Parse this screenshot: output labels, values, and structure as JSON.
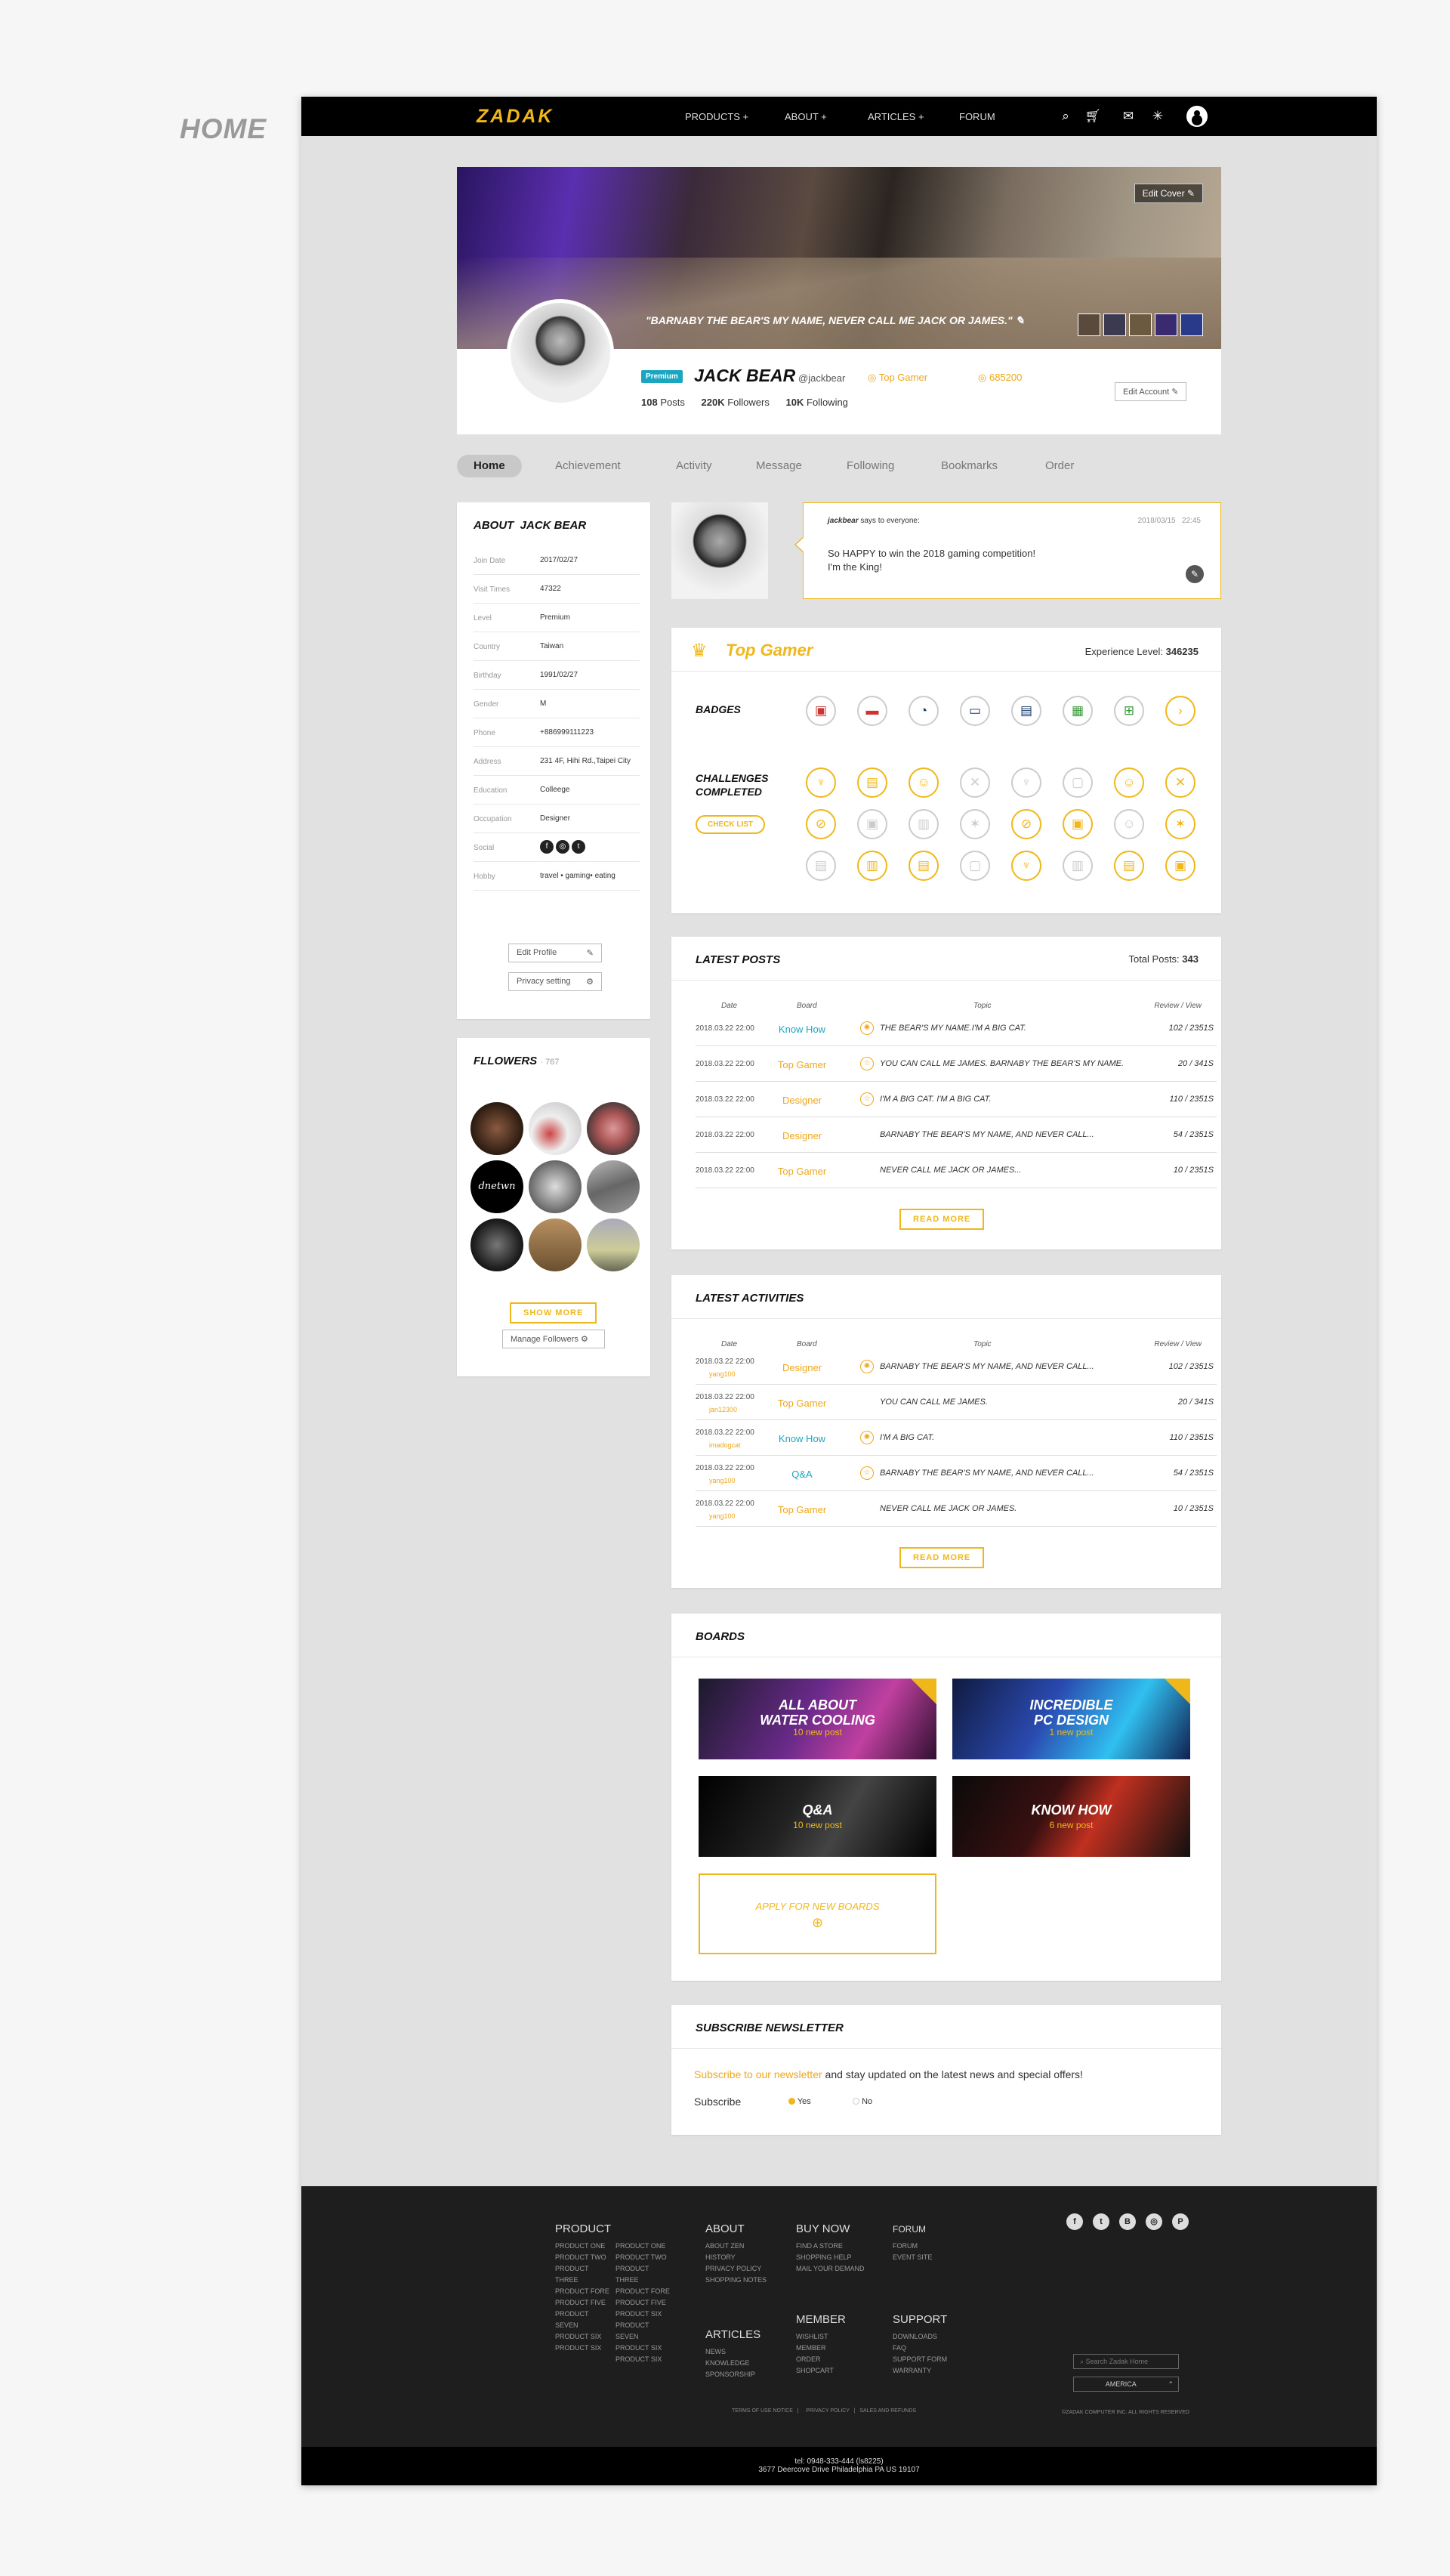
{
  "page_label": "HOME",
  "nav": {
    "logo": "ZADAK",
    "items": [
      "PRODUCTS +",
      "ABOUT +",
      "ARTICLES +",
      "FORUM"
    ],
    "icons": [
      "search-icon",
      "cart-icon",
      "mail-icon",
      "notification-icon",
      "user-avatar"
    ]
  },
  "cover": {
    "edit_label": "Edit Cover",
    "quote": "\"BARNABY THE BEAR'S MY NAME, NEVER CALL ME JACK OR JAMES.\""
  },
  "profile": {
    "badge": "Premium",
    "name": "JACK BEAR",
    "handle": "@jackbear",
    "tag": "Top Gamer",
    "points": "685200",
    "posts_num": "108",
    "posts_label": "Posts",
    "followers_num": "220K",
    "followers_label": "Followers",
    "following_num": "10K",
    "following_label": "Following",
    "edit_account": "Edit Account"
  },
  "tabs": [
    "Home",
    "Achievement",
    "Activity",
    "Message",
    "Following",
    "Bookmarks",
    "Order"
  ],
  "about": {
    "title_prefix": "ABOUT",
    "title_name": "JACK BEAR",
    "rows": [
      {
        "k": "Join Date",
        "v": "2017/02/27"
      },
      {
        "k": "Visit Times",
        "v": "47322"
      },
      {
        "k": "Level",
        "v": "Premium"
      },
      {
        "k": "Country",
        "v": "Taiwan"
      },
      {
        "k": "Birthday",
        "v": "1991/02/27"
      },
      {
        "k": "Gender",
        "v": "M"
      },
      {
        "k": "Phone",
        "v": "+886999111223"
      },
      {
        "k": "Address",
        "v": "231 4F, Hihi Rd.,Taipei City"
      },
      {
        "k": "Education",
        "v": "Colleege"
      },
      {
        "k": "Occupation",
        "v": "Designer"
      },
      {
        "k": "Social",
        "v": ""
      },
      {
        "k": "Hobby",
        "v": "travel • gaming• eating"
      }
    ],
    "edit_profile": "Edit Profile",
    "privacy_setting": "Privacy setting"
  },
  "followers": {
    "title": "FLLOWERS",
    "count": "· 767",
    "show_more": "SHOW MORE",
    "manage": "Manage Followers"
  },
  "status": {
    "author": "jackbear",
    "says": "says to everyone:",
    "date": "2018/03/15",
    "time": "22:45",
    "line1": "So HAPPY to win the 2018 gaming competition!",
    "line2": "I'm the King!"
  },
  "achievement": {
    "title": "Top Gamer",
    "exp_label": "Experience Level:",
    "exp_value": "346235",
    "badges_label": "BADGES",
    "challenges_label1": "CHALLENGES",
    "challenges_label2": "COMPLETED",
    "check_list": "CHECK LIST"
  },
  "latest_posts": {
    "title": "LATEST POSTS",
    "total_label": "Total Posts:",
    "total": "343",
    "headers": [
      "Date",
      "Board",
      "Topic",
      "Review / View"
    ],
    "rows": [
      {
        "date": "2018.03.22  22:00",
        "board": "Know How",
        "topic": "THE BEAR'S MY NAME.I'M A BIG CAT.",
        "rv": "102 / 2351S"
      },
      {
        "date": "2018.03.22  22:00",
        "board": "Top Gamer",
        "topic": "YOU CAN CALL ME JAMES. BARNABY THE BEAR'S MY NAME.",
        "rv": "20 / 341S"
      },
      {
        "date": "2018.03.22  22:00",
        "board": "Designer",
        "topic": "I'M A BIG CAT. I'M A BIG CAT.",
        "rv": "110 / 2351S"
      },
      {
        "date": "2018.03.22  22:00",
        "board": "Designer",
        "topic": "BARNABY THE BEAR'S MY NAME, AND NEVER CALL...",
        "rv": "54 / 2351S"
      },
      {
        "date": "2018.03.22  22:00",
        "board": "Top Gamer",
        "topic": "NEVER CALL ME JACK OR JAMES...",
        "rv": "10 / 2351S"
      }
    ],
    "read_more": "READ MORE"
  },
  "latest_activities": {
    "title": "LATEST ACTIVITIES",
    "headers": [
      "Date",
      "Board",
      "Topic",
      "Review / View"
    ],
    "rows": [
      {
        "date": "2018.03.22  22:00",
        "user": "yang100",
        "board": "Designer",
        "topic": "BARNABY THE BEAR'S MY NAME, AND NEVER CALL...",
        "rv": "102 / 2351S"
      },
      {
        "date": "2018.03.22  22:00",
        "user": "jan12300",
        "board": "Top Gamer",
        "topic": "YOU CAN CALL ME JAMES.",
        "rv": "20 / 341S"
      },
      {
        "date": "2018.03.22  22:00",
        "user": "imadogcat",
        "board": "Know How",
        "topic": "I'M A BIG CAT.",
        "rv": "110 / 2351S"
      },
      {
        "date": "2018.03.22  22:00",
        "user": "yang100",
        "board": "Q&A",
        "topic": "BARNABY THE BEAR'S MY NAME, AND NEVER CALL...",
        "rv": "54 / 2351S"
      },
      {
        "date": "2018.03.22  22:00",
        "user": "yang100",
        "board": "Top Gamer",
        "topic": "NEVER CALL ME JACK OR JAMES.",
        "rv": "10 / 2351S"
      }
    ],
    "read_more": "READ MORE"
  },
  "boards": {
    "title": "BOARDS",
    "items": [
      {
        "l1": "ALL ABOUT",
        "l2": "WATER COOLING",
        "np": "10 new post"
      },
      {
        "l1": "INCREDIBLE",
        "l2": "PC DESIGN",
        "np": "1 new post"
      },
      {
        "l1": "Q&A",
        "l2": "",
        "np": "10 new post"
      },
      {
        "l1": "KNOW HOW",
        "l2": "",
        "np": "6 new post"
      }
    ],
    "apply": "APPLY FOR NEW BOARDS"
  },
  "newsletter": {
    "title": "SUBSCRIBE NEWSLETTER",
    "link": "Subscribe to our newsletter",
    "text": " and stay updated on the latest news and special offers!",
    "subscribe_label": "Subscribe",
    "yes": "Yes",
    "no": "No"
  },
  "footer": {
    "product_h": "PRODUCT",
    "product_col1": "PRODUCT ONE\nPRODUCT TWO\nPRODUCT\nTHREE\nPRODUCT FORE\nPRODUCT FIVE\nPRODUCT\nSEVEN\nPRODUCT SIX\nPRODUCT SIX",
    "product_col2": "PRODUCT ONE\nPRODUCT TWO\nPRODUCT\nTHREE\nPRODUCT FORE\nPRODUCT FIVE\nPRODUCT SIX\nPRODUCT\nSEVEN\nPRODUCT SIX\nPRODUCT SIX",
    "about_h": "ABOUT",
    "about_l": "ABOUT ZEN\nHISTORY\nPRIVACY POLICY\nSHOPPING NOTES",
    "buy_h": "BUY NOW",
    "buy_l": "FIND A STORE\nSHOPPING HELP\nMAIL YOUR DEMAND",
    "forum_h": "FORUM",
    "forum_l": "FORUM\nEVENT SITE",
    "articles_h": "ARTICLES",
    "articles_l": "NEWS\nKNOWLEDGE\nSPONSORSHIP",
    "member_h": "MEMBER",
    "member_l": "WISHLIST\nMEMBER\nORDER\nSHOPCART",
    "support_h": "SUPPORT",
    "support_l": "DOWNLOADS\nFAQ\nSUPPORT FORM\nWARRANTY",
    "search_placeholder": "Search Zadak Home",
    "region": "AMERICA",
    "copyright": "©ZADAK COMPUTER INC. ALL RIGHTS RESERVED",
    "terms": "TERMS OF USE NOTICE",
    "privacy": "PRIVACY POLICY",
    "sales": "SALES AND REFUNDS",
    "tel": "tel: 0948-333-444 (ls8225)",
    "address": "3677 Deercove Drive Philadelphia PA US 19107"
  },
  "colors": {
    "accent": "#f0b71b",
    "cyan": "#1aa6c0",
    "dark": "#1e1e1e"
  }
}
